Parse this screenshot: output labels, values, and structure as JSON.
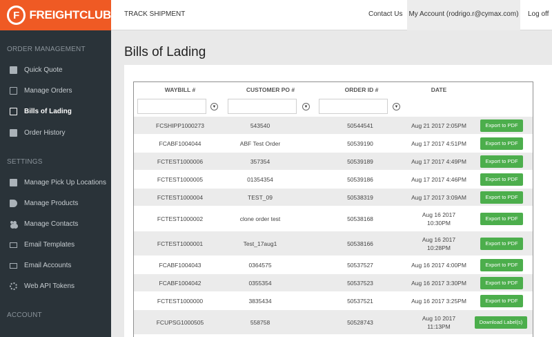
{
  "brand": {
    "mark": "F",
    "name": "FREIGHTCLUB",
    "accent": "#ef5a24"
  },
  "topnav": {
    "track": "TRACK SHIPMENT",
    "contact": "Contact Us",
    "account": "My Account (rodrigo.r@cymax.com)",
    "logoff": "Log off"
  },
  "sidebar": {
    "order_section": "ORDER MANAGEMENT",
    "order_items": [
      {
        "label": "Quick Quote",
        "icon": "truck-icon"
      },
      {
        "label": "Manage Orders",
        "icon": "edit-icon"
      },
      {
        "label": "Bills of Lading",
        "icon": "documents-icon"
      },
      {
        "label": "Order History",
        "icon": "history-icon"
      }
    ],
    "settings_section": "SETTINGS",
    "settings_items": [
      {
        "label": "Manage Pick Up Locations",
        "icon": "building-icon"
      },
      {
        "label": "Manage Products",
        "icon": "tag-icon"
      },
      {
        "label": "Manage Contacts",
        "icon": "users-icon"
      },
      {
        "label": "Email Templates",
        "icon": "envelope-icon"
      },
      {
        "label": "Email Accounts",
        "icon": "envelope-icon"
      },
      {
        "label": "Web API Tokens",
        "icon": "gears-icon"
      }
    ],
    "account_section": "ACCOUNT"
  },
  "page": {
    "title": "Bills of Lading"
  },
  "table": {
    "headers": {
      "waybill": "WAYBILL #",
      "customer_po": "CUSTOMER PO #",
      "order_id": "ORDER ID #",
      "date": "DATE"
    },
    "filters": {
      "waybill": "",
      "customer_po": "",
      "order_id": ""
    },
    "rows": [
      {
        "waybill": "FCSHIPP1000273",
        "po": "543540",
        "order_id": "50544541",
        "date": "Aug 21 2017 2:05PM",
        "action": "Export to PDF"
      },
      {
        "waybill": "FCABF1004044",
        "po": "ABF Test Order",
        "order_id": "50539190",
        "date": "Aug 17 2017 4:51PM",
        "action": "Export to PDF"
      },
      {
        "waybill": "FCTEST1000006",
        "po": "357354",
        "order_id": "50539189",
        "date": "Aug 17 2017 4:49PM",
        "action": "Export to PDF"
      },
      {
        "waybill": "FCTEST1000005",
        "po": "01354354",
        "order_id": "50539186",
        "date": "Aug 17 2017 4:46PM",
        "action": "Export to PDF"
      },
      {
        "waybill": "FCTEST1000004",
        "po": "TEST_09",
        "order_id": "50538319",
        "date": "Aug 17 2017 3:09AM",
        "action": "Export to PDF"
      },
      {
        "waybill": "FCTEST1000002",
        "po": "clone order test",
        "order_id": "50538168",
        "date": "Aug 16 2017 10:30PM",
        "action": "Export to PDF"
      },
      {
        "waybill": "FCTEST1000001",
        "po": "Test_17aug1",
        "order_id": "50538166",
        "date": "Aug 16 2017 10:28PM",
        "action": "Export to PDF"
      },
      {
        "waybill": "FCABF1004043",
        "po": "0364575",
        "order_id": "50537527",
        "date": "Aug 16 2017 4:00PM",
        "action": "Export to PDF"
      },
      {
        "waybill": "FCABF1004042",
        "po": "0355354",
        "order_id": "50537523",
        "date": "Aug 16 2017 3:30PM",
        "action": "Export to PDF"
      },
      {
        "waybill": "FCTEST1000000",
        "po": "3835434",
        "order_id": "50537521",
        "date": "Aug 16 2017 3:25PM",
        "action": "Export to PDF"
      },
      {
        "waybill": "FCUPSG1000505",
        "po": "558758",
        "order_id": "50528743",
        "date": "Aug 10 2017 11:13PM",
        "action": "Download Label(s)"
      }
    ]
  },
  "colors": {
    "sidebar_bg": "#2a3339",
    "button_green": "#4cae4c",
    "row_alt": "#ebebeb"
  }
}
